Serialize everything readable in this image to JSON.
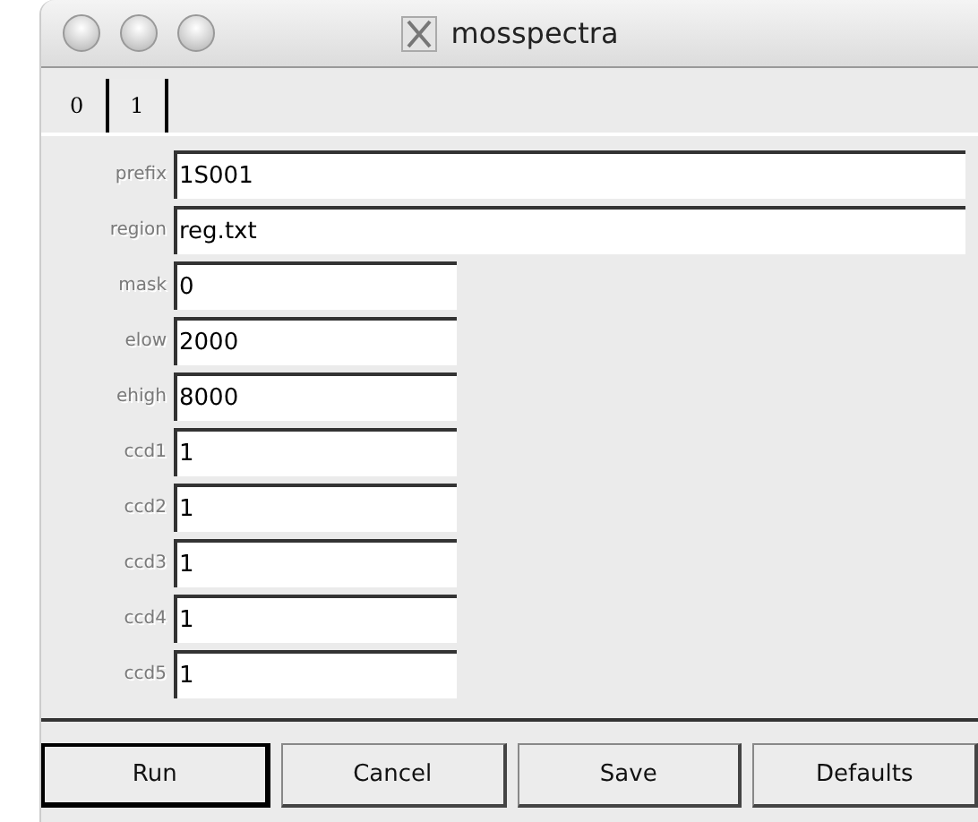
{
  "window": {
    "title": "mosspectra"
  },
  "tabs": [
    {
      "label": "0",
      "selected": true
    },
    {
      "label": "1",
      "selected": false
    }
  ],
  "fields": [
    {
      "label": "prefix",
      "value": "1S001",
      "kind": "wide"
    },
    {
      "label": "region",
      "value": "reg.txt",
      "kind": "wide"
    },
    {
      "label": "mask",
      "value": "0",
      "kind": "narrow"
    },
    {
      "label": "elow",
      "value": "2000",
      "kind": "narrow"
    },
    {
      "label": "ehigh",
      "value": "8000",
      "kind": "narrow"
    },
    {
      "label": "ccd1",
      "value": "1",
      "kind": "narrow"
    },
    {
      "label": "ccd2",
      "value": "1",
      "kind": "narrow"
    },
    {
      "label": "ccd3",
      "value": "1",
      "kind": "narrow"
    },
    {
      "label": "ccd4",
      "value": "1",
      "kind": "narrow"
    },
    {
      "label": "ccd5",
      "value": "1",
      "kind": "narrow"
    }
  ],
  "buttons": [
    {
      "label": "Run",
      "default": true
    },
    {
      "label": "Cancel",
      "default": false
    },
    {
      "label": "Save",
      "default": false
    },
    {
      "label": "Defaults",
      "default": false
    }
  ]
}
